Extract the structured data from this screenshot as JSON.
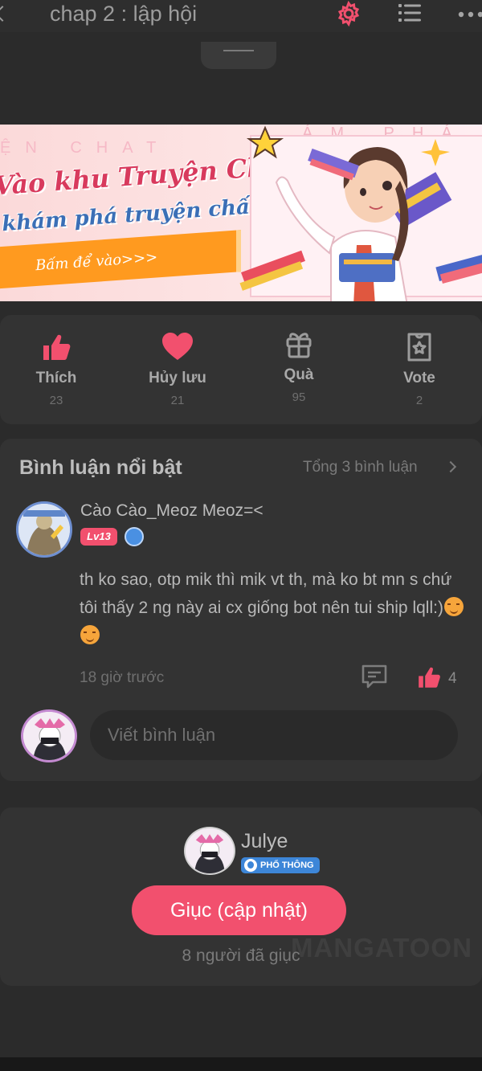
{
  "header": {
    "title": "chap 2 : lập hội",
    "icons": [
      "back-chevron-icon",
      "gear-icon",
      "list-icon",
      "more-icon"
    ],
    "accent": "#f2506e"
  },
  "banner": {
    "ghost_left": "ỆN CHAT",
    "ghost_right": "ÁM PHÁ",
    "line1": "Vào khu Truyện Chat,",
    "line2": "khám phá truyện chất",
    "cta": "Bấm để vào>>>"
  },
  "reactions": [
    {
      "label": "Thích",
      "count": "23",
      "icon": "thumbs-up-icon"
    },
    {
      "label": "Hủy lưu",
      "count": "21",
      "icon": "heart-icon"
    },
    {
      "label": "Quà",
      "count": "95",
      "icon": "gift-icon"
    },
    {
      "label": "Vote",
      "count": "2",
      "icon": "vote-ticket-icon"
    }
  ],
  "comments": {
    "title": "Bình luận nổi bật",
    "total": "Tổng 3 bình luận",
    "item": {
      "user": "Cào Cào_Meoz Meoz=<",
      "level": "Lv13",
      "text": "th ko sao, otp mik thì mik vt th, mà ko bt mn s chứ tôi thấy 2 ng này ai cx giống bot nên tui ship lqll:)",
      "time": "18 giờ trước",
      "likes": "4"
    },
    "reply_placeholder": "Viết bình luận"
  },
  "urge": {
    "author": "Julye",
    "tier": "PHỔ THÔNG",
    "button": "Giục (cập nhật)",
    "count": "8 người đã giục",
    "watermark": "MANGATOON"
  }
}
